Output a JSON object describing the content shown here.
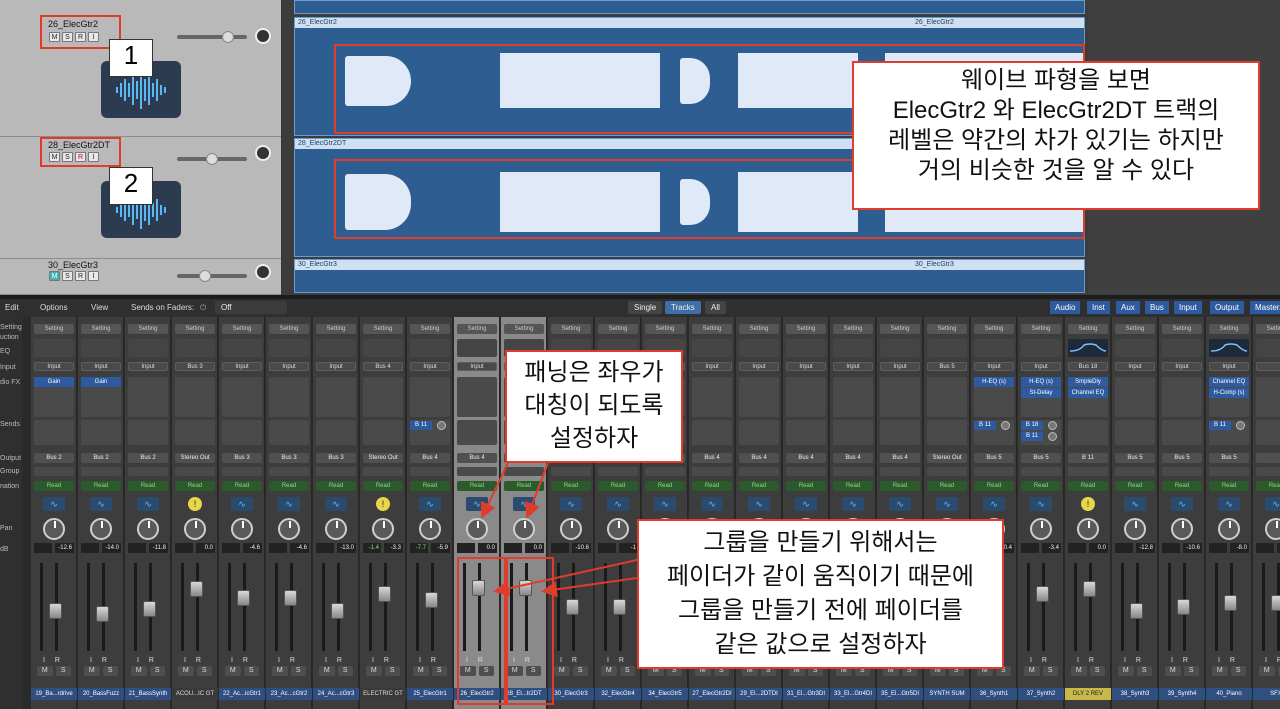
{
  "tracks": [
    {
      "name": "26_ElecGtr2",
      "buttons": [
        "M",
        "S",
        "R",
        "I"
      ],
      "number": "1"
    },
    {
      "name": "28_ElecGtr2DT",
      "buttons": [
        "M",
        "S",
        "R",
        "I"
      ],
      "number": "2"
    },
    {
      "name": "30_ElecGtr3",
      "buttons": [
        "M",
        "S",
        "R",
        "I"
      ]
    }
  ],
  "regions": {
    "r1": "26_ElecGtr2",
    "r1b": "26_ElecGtr2",
    "r2": "28_ElecGtr2DT",
    "r3": "30_ElecGtr3",
    "r3b": "30_ElecGtr3"
  },
  "callouts": {
    "waveform": [
      "웨이브 파형을 보면",
      "ElecGtr2 와 ElecGtr2DT 트랙의",
      "레벨은 약간의 차가 있기는 하지만",
      "거의 비슷한 것을 알 수 있다"
    ],
    "pan": [
      "패닝은 좌우가",
      "대칭이 되도록",
      "설정하자"
    ],
    "group": [
      "그룹을 만들기 위해서는",
      "페이더가 같이 움직이기 때문에",
      "그룹을 만들기 전에 페이더를",
      "같은 값으로 설정하자"
    ]
  },
  "mixer_bar": {
    "edit": "Edit",
    "options": "Options",
    "view": "View",
    "sends_on_faders": "Sends on Faders:",
    "sends_value": "Off"
  },
  "view_toggle": [
    "Single",
    "Tracks",
    "All"
  ],
  "filters": [
    "Audio",
    "Inst",
    "Aux",
    "Bus",
    "Input",
    "Output",
    "Master/"
  ],
  "row_labels": [
    "Setting",
    "uction",
    "EQ",
    "Input",
    "dio FX",
    "Sends",
    "Output",
    "Group",
    "nation",
    "Pan",
    "dB"
  ],
  "setting_label": "Setting",
  "input_label": "Input",
  "auto_label": "Read",
  "ir_label": "I R",
  "ms_labels": [
    "M",
    "S"
  ],
  "strips": [
    {
      "name": "19_Ba...rdrive",
      "input": "Input",
      "plugins": [
        "Gain"
      ],
      "output": "Bus 2",
      "db_l": "",
      "db_r": "-12.6",
      "fader": 0.55
    },
    {
      "name": "20_BassFuzz",
      "input": "Input",
      "plugins": [
        "Gain"
      ],
      "output": "Bus 2",
      "db_l": "",
      "db_r": "-14.0",
      "fader": 0.58
    },
    {
      "name": "21_BassSynth",
      "input": "Input",
      "plugins": [],
      "output": "Bus 2",
      "db_l": "",
      "db_r": "-11.8",
      "fader": 0.52
    },
    {
      "name": "ACOU...IC GT",
      "input": "Bus 3",
      "plugins": [],
      "output": "Stereo Out",
      "db_l": "",
      "db_r": "0.0",
      "fader": 0.3,
      "yellow": true
    },
    {
      "name": "22_Ac...icGtr1",
      "input": "Input",
      "plugins": [],
      "output": "Bus 3",
      "db_l": "",
      "db_r": "-4.6",
      "fader": 0.4
    },
    {
      "name": "23_Ac...cGtr2",
      "input": "Input",
      "plugins": [],
      "output": "Bus 3",
      "db_l": "",
      "db_r": "-4.6",
      "fader": 0.4
    },
    {
      "name": "24_Ac...cGtr3",
      "input": "Input",
      "plugins": [],
      "output": "Bus 3",
      "db_l": "",
      "db_r": "-13.0",
      "fader": 0.55
    },
    {
      "name": "ELECTRIC GT",
      "input": "Bus 4",
      "plugins": [],
      "output": "Stereo Out",
      "db_l": "-1.4",
      "db_r": "-3.3",
      "fader": 0.35,
      "yellow": true
    },
    {
      "name": "25_ElecGtr1",
      "input": "Input",
      "plugins": [],
      "send": "B 11",
      "output": "Bus 4",
      "db_l": "-7.7",
      "db_r": "-5.9",
      "fader": 0.42
    },
    {
      "name": "26_ElecGtr2",
      "input": "Input",
      "plugins": [],
      "output": "Bus 4",
      "db_l": "",
      "db_r": "0.0",
      "fader": 0.28,
      "sel": true
    },
    {
      "name": "28_El...tr2DT",
      "input": "Input",
      "plugins": [],
      "output": "Bus 4",
      "db_l": "",
      "db_r": "0.0",
      "fader": 0.28,
      "sel": true
    },
    {
      "name": "30_ElecGtr3",
      "input": "Input",
      "plugins": [],
      "output": "Bus 4",
      "db_l": "",
      "db_r": "-10.6",
      "fader": 0.5
    },
    {
      "name": "32_ElecGtr4",
      "input": "Input",
      "plugins": [],
      "output": "Bus 4",
      "db_l": "",
      "db_r": "-1",
      "fader": 0.5
    },
    {
      "name": "34_ElecGtr5",
      "input": "Input",
      "plugins": [],
      "output": "Bus 4",
      "db_l": "",
      "db_r": "",
      "fader": 0.45
    },
    {
      "name": "27_ElecGtr2DI",
      "input": "Input",
      "plugins": [],
      "output": "Bus 4",
      "db_l": "",
      "db_r": "",
      "fader": 0.45
    },
    {
      "name": "29_El...2DTDI",
      "input": "Input",
      "plugins": [],
      "output": "Bus 4",
      "db_l": "",
      "db_r": "",
      "fader": 0.45
    },
    {
      "name": "31_El...Gtr3DI",
      "input": "Input",
      "plugins": [],
      "output": "Bus 4",
      "db_l": "",
      "db_r": "",
      "fader": 0.45
    },
    {
      "name": "33_El...Gtr4DI",
      "input": "Input",
      "plugins": [],
      "output": "Bus 4",
      "db_l": "",
      "db_r": "",
      "fader": 0.45
    },
    {
      "name": "35_El...Gtr5DI",
      "input": "Input",
      "plugins": [],
      "output": "Bus 4",
      "db_l": "",
      "db_r": "",
      "fader": 0.45
    },
    {
      "name": "SYNTH SUM",
      "input": "Bus 5",
      "plugins": [],
      "output": "Stereo Out",
      "db_l": "",
      "db_r": "",
      "fader": 0.3
    },
    {
      "name": "36_Synth1",
      "input": "Input",
      "plugins": [
        "H-EQ (s)"
      ],
      "send": "B 11",
      "output": "Bus 5",
      "db_l": "",
      "db_r": "10.4",
      "fader": 0.45
    },
    {
      "name": "37_Synth2",
      "input": "Input",
      "plugins": [
        "H-EQ (s)",
        "St-Delay"
      ],
      "send": "B 18",
      "send2": "B 11",
      "output": "Bus 5",
      "db_l": "",
      "db_r": "-3.4",
      "fader": 0.35
    },
    {
      "name": "DLY 2 REV",
      "input": "Bus 18",
      "plugins": [
        "SmpleDly",
        "Channel EQ"
      ],
      "output": "B 11",
      "db_l": "",
      "db_r": "0.0",
      "fader": 0.3,
      "yellow": true,
      "eqgraph": true,
      "ylabel": true
    },
    {
      "name": "38_Synth3",
      "input": "Input",
      "plugins": [],
      "output": "Bus 5",
      "db_l": "",
      "db_r": "-12.8",
      "fader": 0.55
    },
    {
      "name": "39_Synth4",
      "input": "Input",
      "plugins": [],
      "output": "Bus 5",
      "db_l": "",
      "db_r": "-10.6",
      "fader": 0.5
    },
    {
      "name": "40_Piano",
      "input": "Input",
      "plugins": [
        "Channel EQ",
        "H-Comp (s)"
      ],
      "send": "B 11",
      "output": "Bus 5",
      "db_l": "",
      "db_r": "-8.0",
      "fader": 0.45,
      "eqgraph": true
    },
    {
      "name": "SFX",
      "input": "",
      "plugins": [],
      "output": "",
      "db_l": "",
      "db_r": "",
      "fader": 0.45
    }
  ]
}
